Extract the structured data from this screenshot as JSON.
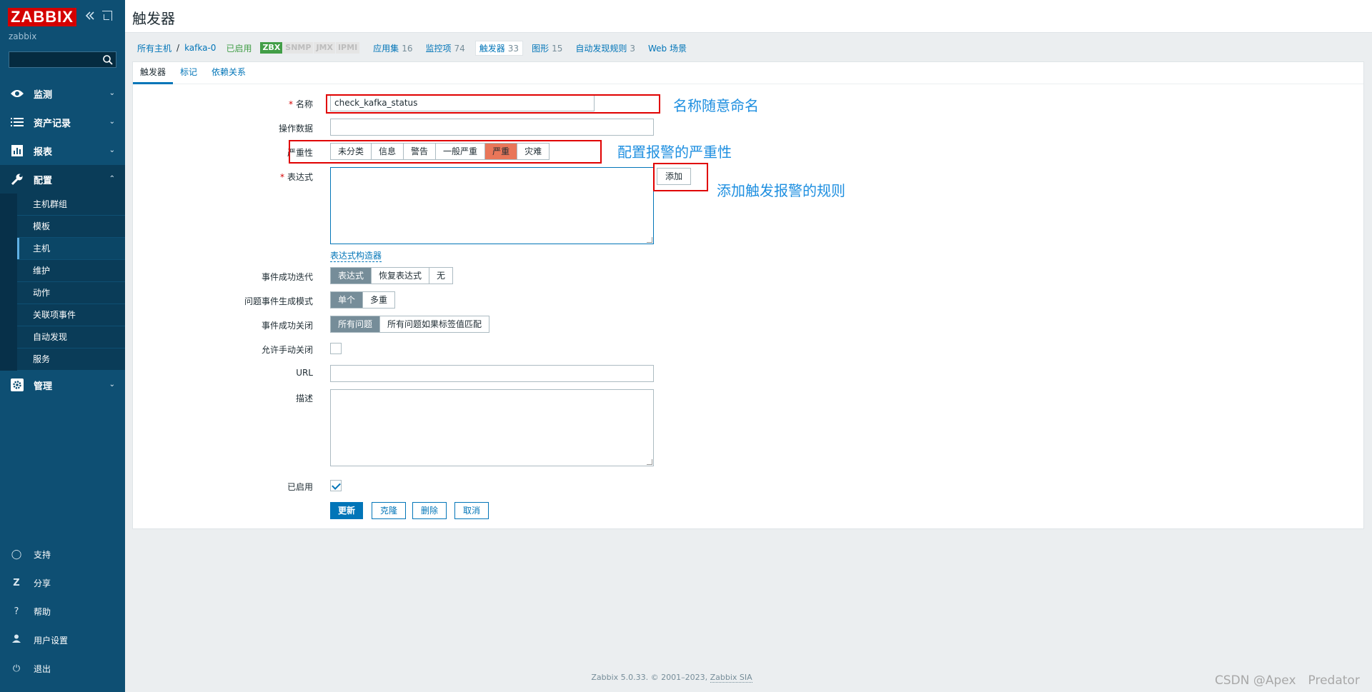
{
  "sidebar": {
    "logo": "ZABBIX",
    "server": "zabbix",
    "search_placeholder": "",
    "menu": [
      {
        "label": "监测",
        "icon": "eye-icon"
      },
      {
        "label": "资产记录",
        "icon": "list-icon"
      },
      {
        "label": "报表",
        "icon": "chart-icon"
      },
      {
        "label": "配置",
        "icon": "wrench-icon"
      },
      {
        "label": "管理",
        "icon": "gear-icon"
      }
    ],
    "config_sub": [
      "主机群组",
      "模板",
      "主机",
      "维护",
      "动作",
      "关联项事件",
      "自动发现",
      "服务"
    ],
    "bottom": [
      {
        "label": "支持",
        "icon": "headset-icon"
      },
      {
        "label": "分享",
        "icon": "share-icon"
      },
      {
        "label": "帮助",
        "icon": "help-icon"
      },
      {
        "label": "用户设置",
        "icon": "user-icon"
      },
      {
        "label": "退出",
        "icon": "power-icon"
      }
    ]
  },
  "header": {
    "title": "触发器"
  },
  "host_nav": {
    "all_hosts": "所有主机",
    "sep": "/",
    "host": "kafka-0",
    "status": "已启用",
    "tags": [
      "ZBX",
      "SNMP",
      "JMX",
      "IPMI"
    ],
    "links": [
      {
        "label": "应用集",
        "count": "16"
      },
      {
        "label": "监控项",
        "count": "74"
      },
      {
        "label": "触发器",
        "count": "33"
      },
      {
        "label": "图形",
        "count": "15"
      },
      {
        "label": "自动发现规则",
        "count": "3"
      },
      {
        "label": "Web 场景",
        "count": ""
      }
    ]
  },
  "tabs": [
    "触发器",
    "标记",
    "依赖关系"
  ],
  "form": {
    "name_label": "名称",
    "name_value": "check_kafka_status",
    "opdata_label": "操作数据",
    "opdata_value": "",
    "severity_label": "严重性",
    "severity_options": [
      "未分类",
      "信息",
      "警告",
      "一般严重",
      "严重",
      "灾难"
    ],
    "expression_label": "表达式",
    "add_button": "添加",
    "expr_builder": "表达式构造器",
    "ok_event_label": "事件成功迭代",
    "ok_event_options": [
      "表达式",
      "恢复表达式",
      "无"
    ],
    "mode_label": "问题事件生成模式",
    "mode_options": [
      "单个",
      "多重"
    ],
    "close_label": "事件成功关闭",
    "close_options": [
      "所有问题",
      "所有问题如果标签值匹配"
    ],
    "manual_close_label": "允许手动关闭",
    "url_label": "URL",
    "url_value": "",
    "desc_label": "描述",
    "enabled_label": "已启用",
    "buttons": {
      "update": "更新",
      "clone": "克隆",
      "delete": "删除",
      "cancel": "取消"
    }
  },
  "annotations": {
    "name_note": "名称随意命名",
    "severity_note": "配置报警的严重性",
    "expr_note": "添加触发报警的规则"
  },
  "footer": {
    "text": "Zabbix 5.0.33. © 2001–2023, ",
    "company": "Zabbix SIA"
  },
  "watermark": "CSDN @Apex　Predator",
  "colors": {
    "sidebar": "#0e4f73",
    "logo": "#d40000",
    "link": "#0275b8",
    "severity_high": "#e97659",
    "annotation": "#1e8fe0"
  }
}
